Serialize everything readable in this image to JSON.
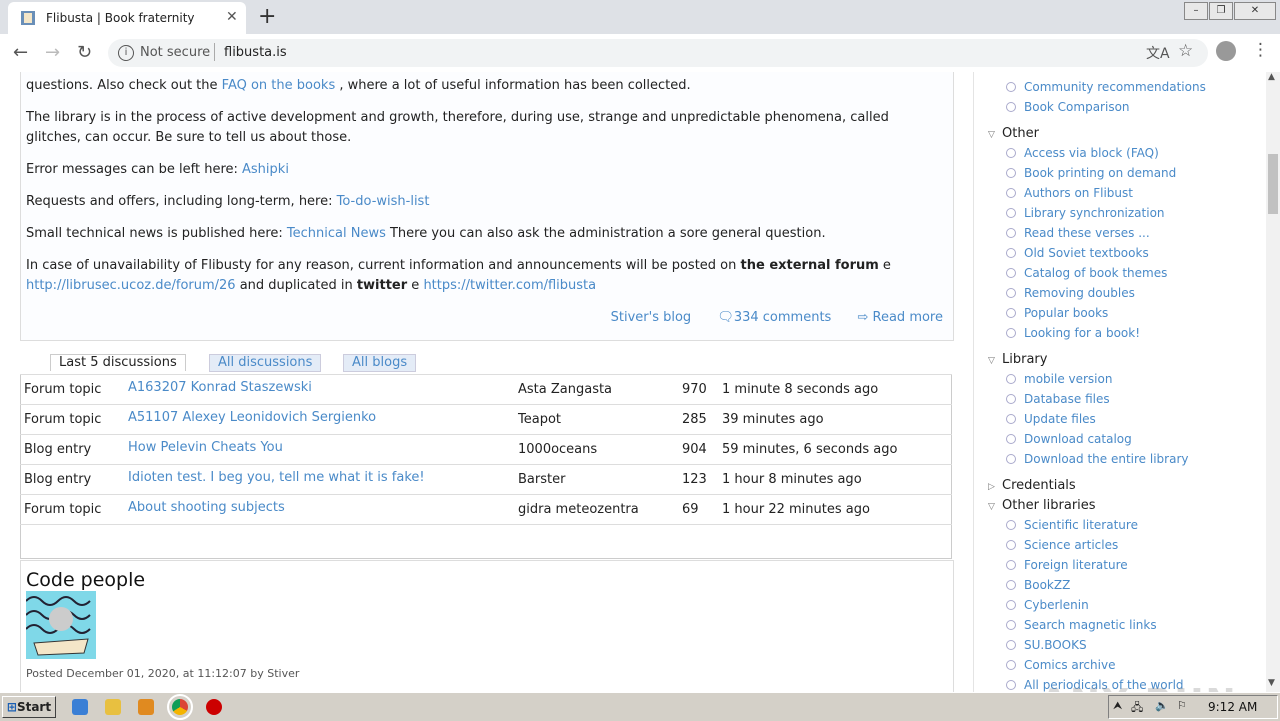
{
  "browser": {
    "tab_title": "Flibusta | Book fraternity",
    "tab_close": "✕",
    "new_tab": "+",
    "security_text": "Not secure",
    "url": "flibusta.is"
  },
  "main": {
    "paragraphs": [
      {
        "prefix": "questions. Also check out the ",
        "link": "FAQ on the books",
        "suffix": " , where a lot of useful information has been collected."
      },
      {
        "text": "The library is in the process of active development and growth, therefore, during use, strange and unpredictable phenomena, called glitches, can occur. Be sure to tell us about those."
      },
      {
        "prefix": "Error messages can be left here: ",
        "link": "Ashipki"
      },
      {
        "prefix": "Requests and offers, including long-term, here: ",
        "link": "To-do-wish-list"
      },
      {
        "prefix": "Small technical news is published here: ",
        "link": "Technical News",
        "suffix": " There you can also ask the administration a sore general question."
      },
      {
        "prefix": "In case of unavailability of Flibusty for any reason, current information and announcements will be posted on ",
        "bold1": "the external forum",
        "mid1": " e ",
        "link1": "http://librusec.ucoz.de/forum/26",
        "mid2": " and duplicated in ",
        "bold2": "twitter",
        "mid3": " e ",
        "link2": "https://twitter.com/flibusta"
      }
    ],
    "blog_link": "Stiver's blog",
    "comments": "334 comments",
    "read_more": "Read more"
  },
  "discussions": {
    "tabs": [
      "Last 5 discussions",
      "All discussions",
      "All blogs"
    ],
    "rows": [
      {
        "type": "Forum topic",
        "title": "A163207 Konrad Staszewski",
        "author": "Asta Zangasta",
        "count": "970",
        "time": "1 minute 8 seconds ago"
      },
      {
        "type": "Forum topic",
        "title": "A51107 Alexey Leonidovich Sergienko",
        "author": "Teapot",
        "count": "285",
        "time": "39 minutes ago"
      },
      {
        "type": "Blog entry",
        "title": "How Pelevin Cheats You",
        "author": "1000oceans",
        "count": "904",
        "time": "59 minutes, 6 seconds ago"
      },
      {
        "type": "Blog entry",
        "title": "Idioten test. I beg you, tell me what it is fake!",
        "author": "Barster",
        "count": "123",
        "time": "1 hour 8 minutes ago"
      },
      {
        "type": "Forum topic",
        "title": "About shooting subjects",
        "author": "gidra meteozentra",
        "count": "69",
        "time": "1 hour 22 minutes ago"
      }
    ]
  },
  "code_people": {
    "title": "Code people",
    "meta": "Posted December 01, 2020, at 11:12:07 by Stiver"
  },
  "sidebar": {
    "top_items": [
      "Community recommendations",
      "Book Comparison"
    ],
    "other": {
      "title": "Other",
      "items": [
        "Access via block (FAQ)",
        "Book printing on demand",
        "Authors on Flibust",
        "Library synchronization",
        "Read these verses ...",
        "Old Soviet textbooks",
        "Catalog of book themes",
        "Removing doubles",
        "Popular books",
        "Looking for a book!"
      ]
    },
    "library": {
      "title": "Library",
      "items": [
        "mobile version",
        "Database files",
        "Update files",
        "Download catalog",
        "Download the entire library"
      ]
    },
    "credentials": "Credentials",
    "other_libraries": {
      "title": "Other libraries",
      "items": [
        "Scientific literature",
        "Science articles",
        "Foreign literature",
        "BookZZ",
        "Cyberlenin",
        "Search magnetic links",
        "SU.BOOKS",
        "Comics archive",
        "All periodicals of the world"
      ]
    }
  },
  "watermark": "ANY RUN",
  "taskbar": {
    "start": "Start",
    "clock": "9:12 AM"
  }
}
